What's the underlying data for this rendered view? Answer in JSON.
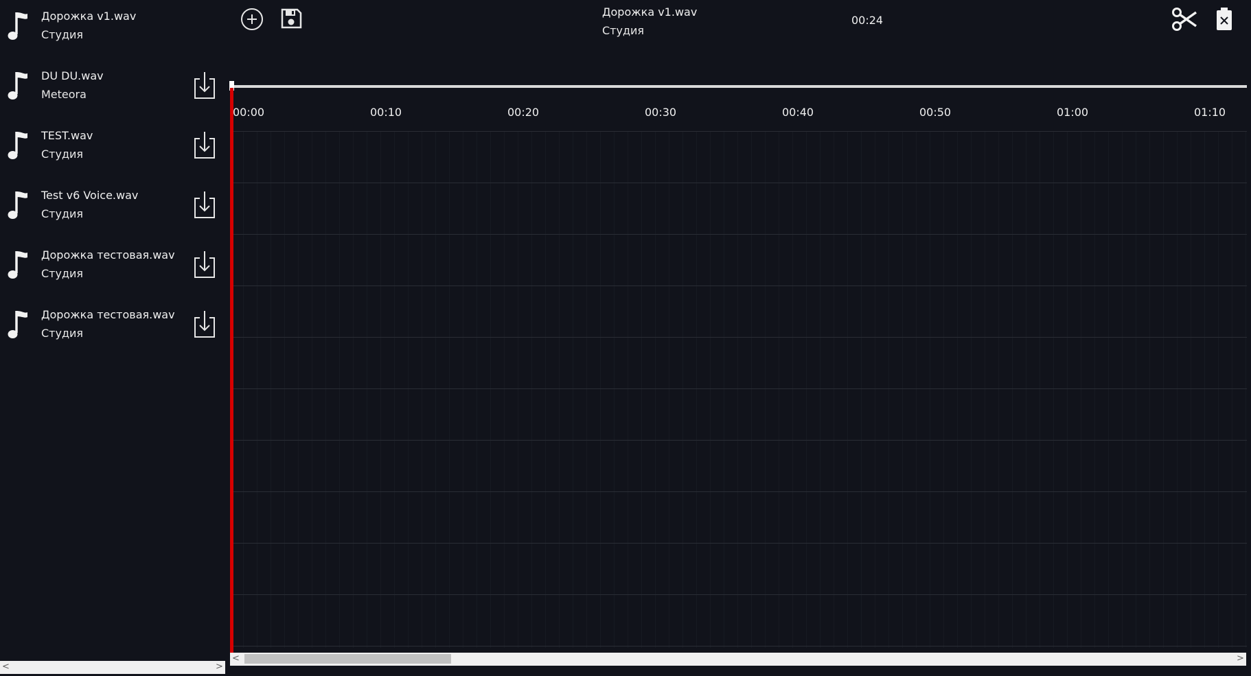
{
  "sidebar": {
    "tracks": [
      {
        "title": "Дорожка v1.wav",
        "artist": "Студия",
        "has_download": false
      },
      {
        "title": "DU DU.wav",
        "artist": "Meteora",
        "has_download": true
      },
      {
        "title": "TEST.wav",
        "artist": "Студия",
        "has_download": true
      },
      {
        "title": "Test v6 Voice.wav",
        "artist": "Студия",
        "has_download": true
      },
      {
        "title": "Дорожка тестовая.wav",
        "artist": "Студия",
        "has_download": true
      },
      {
        "title": "Дорожка тестовая.wav",
        "artist": "Студия",
        "has_download": true
      }
    ],
    "track_icon": "music-note-icon",
    "download_icon": "download-icon"
  },
  "toolbar": {
    "add_icon": "add-circle-icon",
    "save_icon": "floppy-disk-icon",
    "cut_icon": "scissors-icon",
    "delete_icon": "trash-icon"
  },
  "now_playing": {
    "title": "Дорожка v1.wav",
    "artist": "Студия",
    "time": "00:24"
  },
  "timeline": {
    "ticks": [
      "00:00",
      "00:10",
      "00:20",
      "00:30",
      "00:40",
      "00:50",
      "01:00",
      "01:10"
    ],
    "playhead_position": "00:00",
    "lanes": 10
  },
  "colors": {
    "background": "#11131b",
    "playhead": "#d50000",
    "text": "#f0f0f0",
    "ruler": "#d9d9d9"
  }
}
